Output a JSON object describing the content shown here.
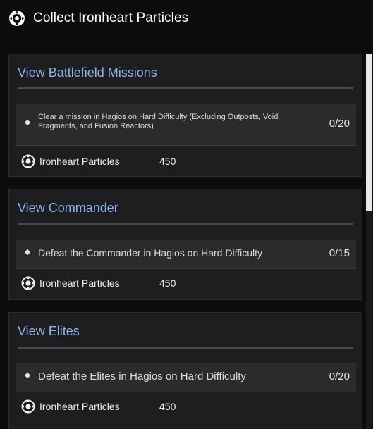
{
  "header": {
    "title": "Collect Ironheart Particles",
    "icon": "particle-icon"
  },
  "cards": [
    {
      "title": "View Battlefield Missions",
      "mission": "Clear a mission in Hagios on Hard Difficulty (Excluding Outposts, Void Fragments, and Fusion Reactors)",
      "progress": "0/20",
      "reward_name": "Ironheart Particles",
      "reward_amount": "450"
    },
    {
      "title": "View Commander",
      "mission": "Defeat the Commander in Hagios on Hard Difficulty",
      "progress": "0/15",
      "reward_name": "Ironheart Particles",
      "reward_amount": "450"
    },
    {
      "title": "View Elites",
      "mission": "Defeat the Elites in Hagios on Hard Difficulty",
      "progress": "0/20",
      "reward_name": "Ironheart Particles",
      "reward_amount": "450"
    }
  ],
  "colors": {
    "accent": "#8fb3ee",
    "background": "#0c0c0d",
    "card": "#1e1e20"
  }
}
